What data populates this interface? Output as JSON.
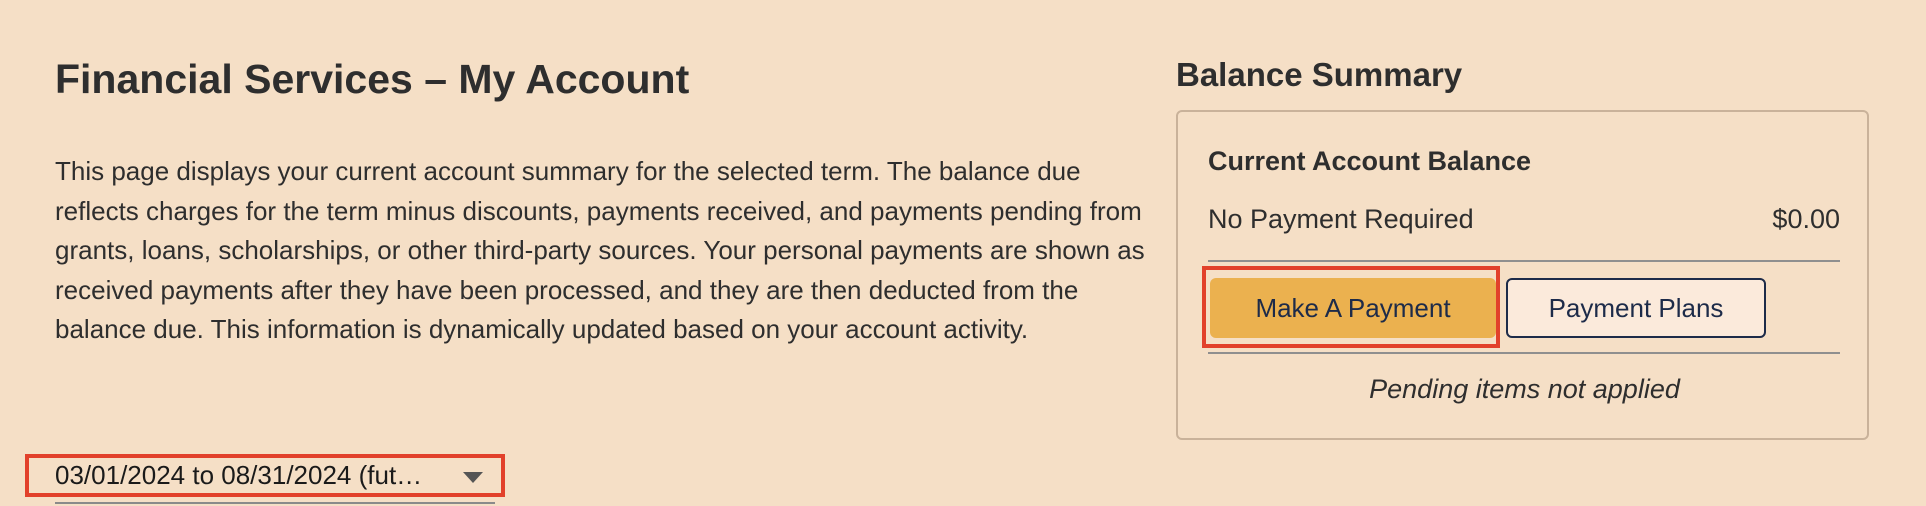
{
  "header": {
    "title": "Financial Services – My Account"
  },
  "intro": {
    "text": "This page displays your current account summary for the selected term. The balance due reflects charges for the term minus discounts, payments received, and payments pending from grants, loans, scholarships, or other third-party sources. Your personal payments are shown as received payments after they have been processed, and they are then deducted from the balance due. This information is dynamically updated based on your account activity."
  },
  "term_selector": {
    "selected": "03/01/2024 to 08/31/2024 (fut…",
    "icon": "chevron-down-icon"
  },
  "balance_summary": {
    "heading": "Balance Summary",
    "card_title": "Current Account Balance",
    "status_label": "No Payment Required",
    "amount": "$0.00",
    "pay_button": "Make A Payment",
    "plans_button": "Payment Plans",
    "pending_note": "Pending items not applied"
  },
  "colors": {
    "background": "#f5dfc6",
    "pay_button": "#ebb14f",
    "highlight": "#e2412b",
    "button_text": "#1d2b49"
  }
}
